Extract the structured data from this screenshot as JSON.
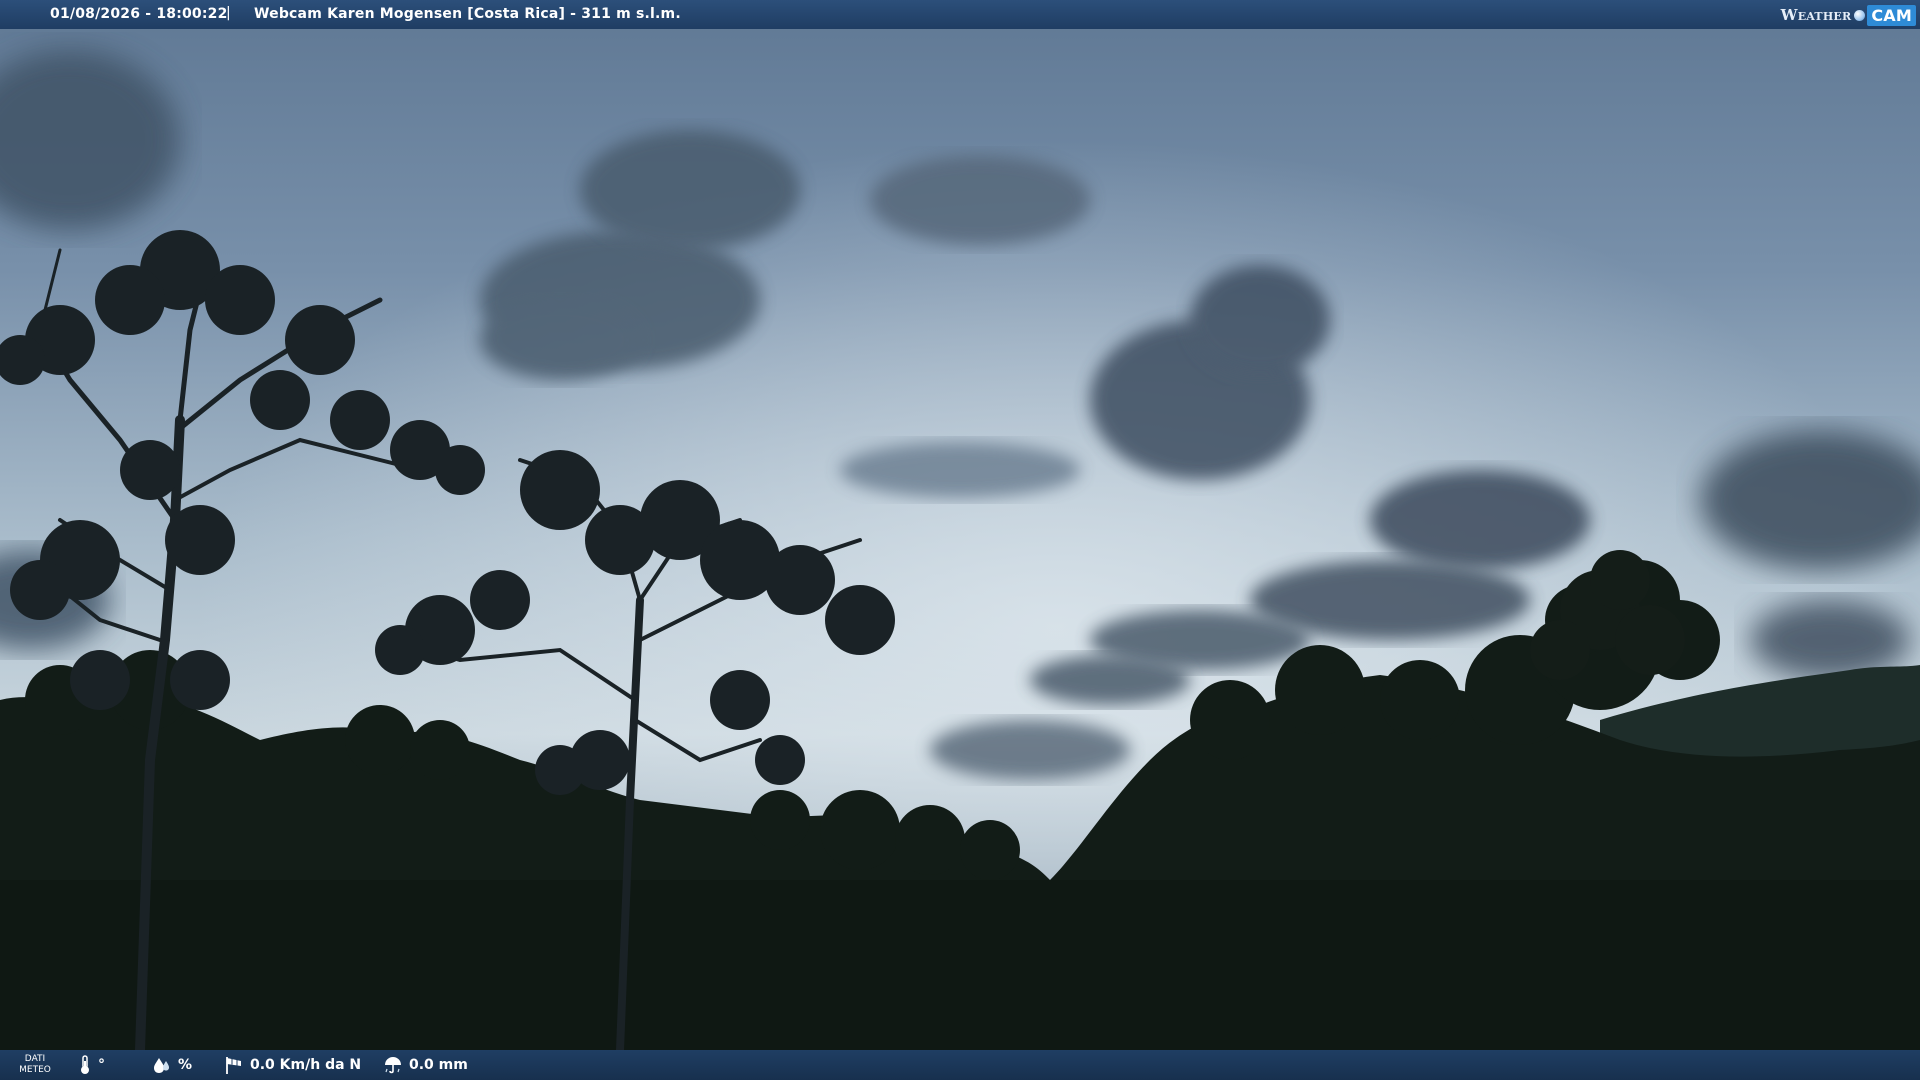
{
  "header": {
    "timestamp": "01/08/2026 - 18:00:22",
    "separator": "|",
    "caption": "Webcam Karen Mogensen [Costa Rica]  - 311 m s.l.m.",
    "brand_left": "Weather",
    "brand_right": "CAM"
  },
  "footer": {
    "dati_line1": "DATI",
    "dati_line2": "METEO",
    "temperature": "°",
    "humidity": "%",
    "wind": "0.0 Km/h da N",
    "rain": "0.0 mm"
  },
  "colors": {
    "bar": "#1f3d63",
    "brand_accent": "#2e8bd6",
    "sky_top": "#6c86a3",
    "sky_horizon": "#c8d6df",
    "foliage": "#111b16"
  },
  "icons": {
    "temperature": "thermometer-icon",
    "humidity": "droplets-icon",
    "wind": "windsock-icon",
    "rain": "umbrella-icon"
  }
}
